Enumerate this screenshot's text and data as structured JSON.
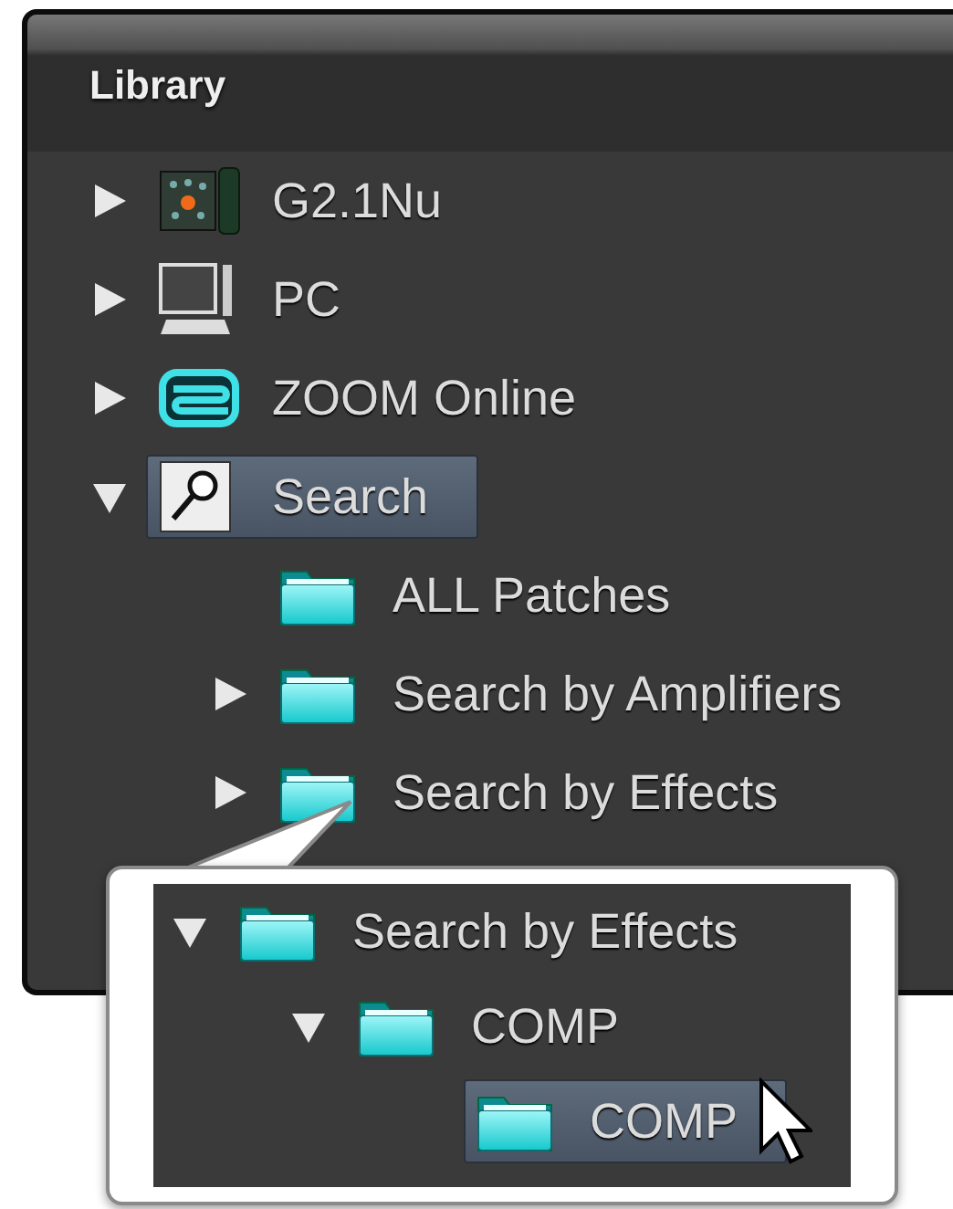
{
  "panel": {
    "title": "Library"
  },
  "tree": [
    {
      "label": "G2.1Nu",
      "kind": "device",
      "expanded": false,
      "selected": false
    },
    {
      "label": "PC",
      "kind": "computer",
      "expanded": false,
      "selected": false
    },
    {
      "label": "ZOOM Online",
      "kind": "logo",
      "expanded": false,
      "selected": false
    },
    {
      "label": "Search",
      "kind": "search",
      "expanded": true,
      "selected": true,
      "children": [
        {
          "label": "ALL Patches",
          "kind": "folder",
          "selected": false
        },
        {
          "label": "Search by Amplifiers",
          "kind": "folder",
          "expanded": false,
          "selected": false
        },
        {
          "label": "Search by Effects",
          "kind": "folder",
          "expanded": false,
          "selected": false
        }
      ]
    }
  ],
  "callout": {
    "tree": [
      {
        "label": "Search by Effects",
        "kind": "folder",
        "expanded": true,
        "selected": false,
        "children": [
          {
            "label": "COMP",
            "kind": "folder",
            "expanded": true,
            "selected": false,
            "children": [
              {
                "label": "COMP",
                "kind": "folder",
                "selected": true
              }
            ]
          }
        ]
      }
    ]
  }
}
